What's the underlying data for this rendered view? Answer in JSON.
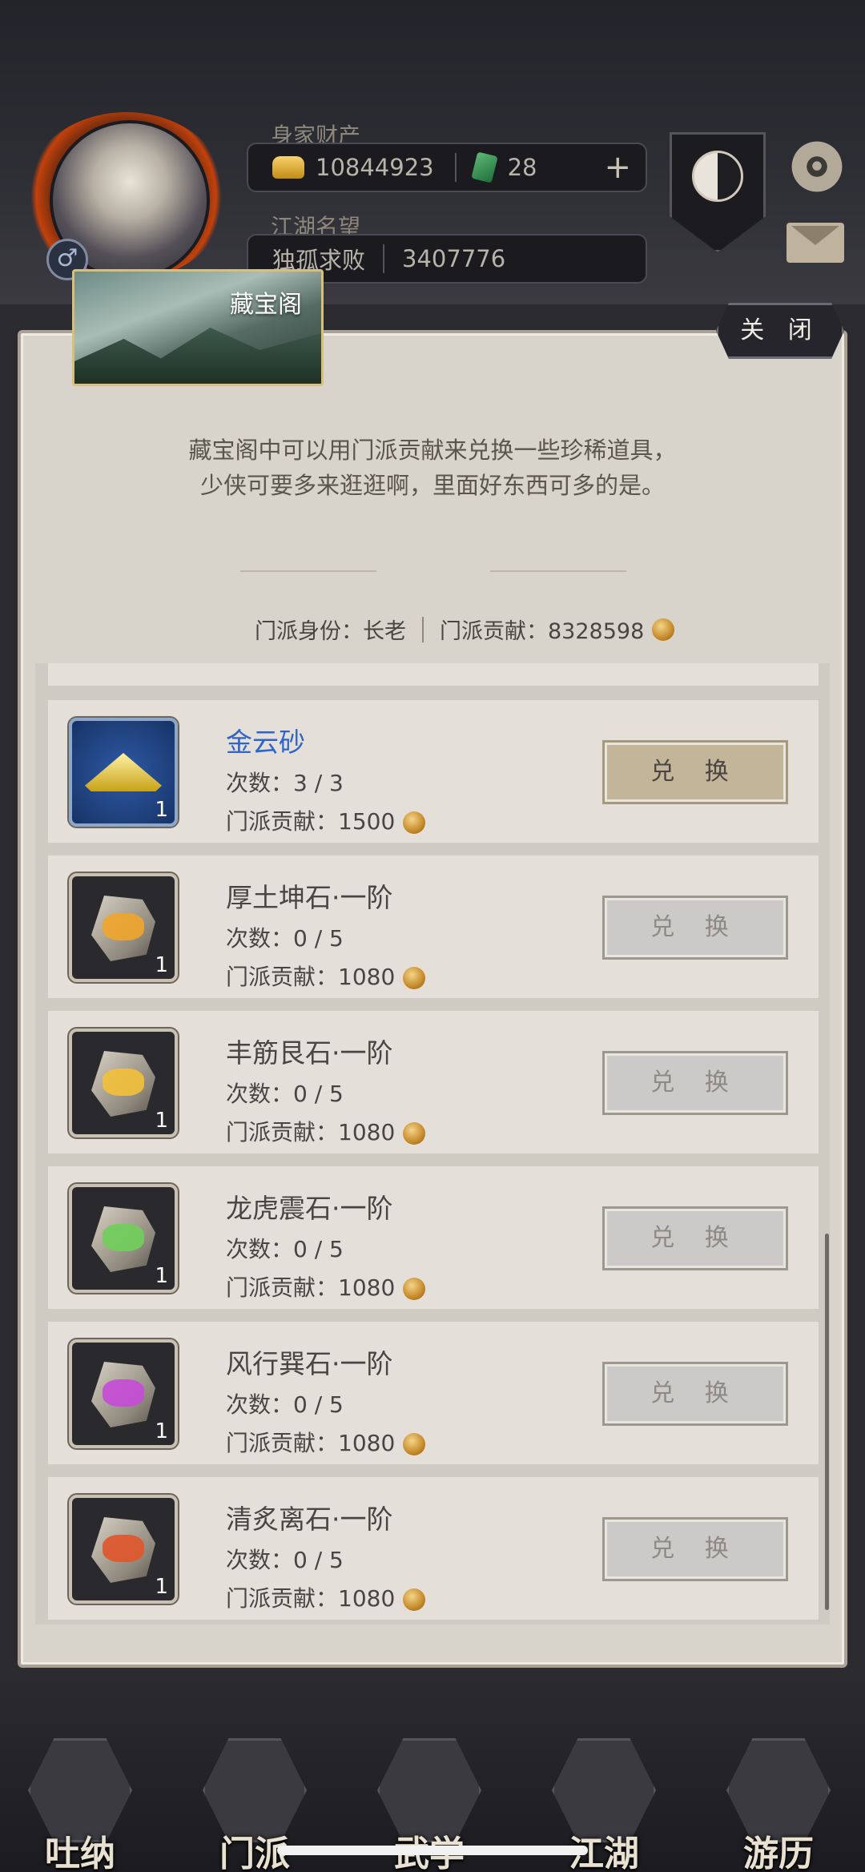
{
  "header": {
    "wealth_label": "身家财产",
    "gold": "10844923",
    "jade": "28",
    "plus_label": "+",
    "fame_label": "江湖名望",
    "title": "独孤求败",
    "fame_value": "3407776",
    "gender_symbol": "♂"
  },
  "modal": {
    "tab_title": "藏宝阁",
    "close_label": "关 闭",
    "intro_line1": "藏宝阁中可以用门派贡献来兑换一些珍稀道具，",
    "intro_line2": "少侠可要多来逛逛啊，里面好东西可多的是。",
    "identity": "门派身份：长老",
    "contribution": "门派贡献：8328598"
  },
  "items": [
    {
      "name": "金云砂",
      "count": "次数：3 / 3",
      "cost": "门派贡献：1500",
      "qty": "1",
      "button": "兑 换"
    },
    {
      "name": "厚土坤石·一阶",
      "count": "次数：0 / 5",
      "cost": "门派贡献：1080",
      "qty": "1",
      "button": "兑 换"
    },
    {
      "name": "丰筋艮石·一阶",
      "count": "次数：0 / 5",
      "cost": "门派贡献：1080",
      "qty": "1",
      "button": "兑 换"
    },
    {
      "name": "龙虎震石·一阶",
      "count": "次数：0 / 5",
      "cost": "门派贡献：1080",
      "qty": "1",
      "button": "兑 换"
    },
    {
      "name": "风行巽石·一阶",
      "count": "次数：0 / 5",
      "cost": "门派贡献：1080",
      "qty": "1",
      "button": "兑 换"
    },
    {
      "name": "清炙离石·一阶",
      "count": "次数：0 / 5",
      "cost": "门派贡献：1080",
      "qty": "1",
      "button": "兑 换"
    }
  ],
  "colors": {
    "stone_glows": [
      "#f0a52a",
      "#f0a52a",
      "#f2c13a",
      "#6fcf5a",
      "#c64ad8",
      "#e0552b"
    ]
  },
  "nav": [
    {
      "label": "吐纳"
    },
    {
      "label": "门派"
    },
    {
      "label": "武学"
    },
    {
      "label": "江湖"
    },
    {
      "label": "游历"
    }
  ]
}
